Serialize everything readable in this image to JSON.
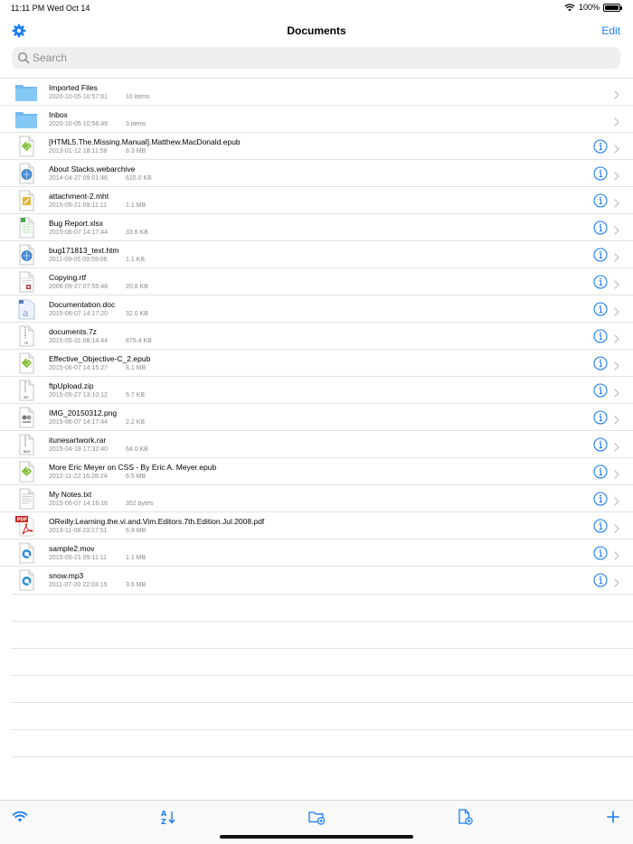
{
  "status_bar": {
    "time": "11:11 PM",
    "date": "Wed Oct 14",
    "battery": "100%"
  },
  "nav": {
    "title": "Documents",
    "edit_label": "Edit"
  },
  "search": {
    "placeholder": "Search"
  },
  "colors": {
    "accent": "#1a7cf3",
    "folder": "#7cc4f2"
  },
  "files": [
    {
      "name": "Imported Files",
      "date": "2020-10-05 10:57:01",
      "size": "10 items",
      "icon": "folder-icon",
      "info": false
    },
    {
      "name": "Inbox",
      "date": "2020-10-05 10:56:49",
      "size": "3 items",
      "icon": "folder-icon",
      "info": false
    },
    {
      "name": "[HTML5.The.Missing.Manual].Matthew.MacDonald.epub",
      "date": "2013-01-12 18:11:58",
      "size": "8.3 MB",
      "icon": "epub-icon",
      "info": true
    },
    {
      "name": "About Stacks.webarchive",
      "date": "2014-04-27 09:01:46",
      "size": "615.0 KB",
      "icon": "webarchive-icon",
      "info": true
    },
    {
      "name": "attachment-2.mht",
      "date": "2015-05-21 09:11:11",
      "size": "1.1 MB",
      "icon": "mht-icon",
      "info": true
    },
    {
      "name": "Bug Report.xlsx",
      "date": "2015-06-07 14:17:44",
      "size": "33.6 KB",
      "icon": "xlsx-icon",
      "info": true
    },
    {
      "name": "bug171813_text.htm",
      "date": "2011-09-05 09:59:06",
      "size": "1.1 KB",
      "icon": "htm-icon",
      "info": true
    },
    {
      "name": "Copying.rtf",
      "date": "2006-09-27 07:55:48",
      "size": "20.8 KB",
      "icon": "rtf-icon",
      "info": true
    },
    {
      "name": "Documentation.doc",
      "date": "2015-06-07 14:17:20",
      "size": "32.0 KB",
      "icon": "doc-icon",
      "info": true
    },
    {
      "name": "documents.7z",
      "date": "2015-05-31 08:14:44",
      "size": "875.4 KB",
      "icon": "archive-7z-icon",
      "info": true
    },
    {
      "name": "Effective_Objective-C_2.epub",
      "date": "2015-06-07 14:15:27",
      "size": "8.1 MB",
      "icon": "epub-icon",
      "info": true
    },
    {
      "name": "ftpUpload.zip",
      "date": "2015-05-27 13:10:12",
      "size": "5.7 KB",
      "icon": "zip-icon",
      "info": true
    },
    {
      "name": "IMG_20150312.png",
      "date": "2015-06-07 14:17:44",
      "size": "2.2 KB",
      "icon": "image-icon",
      "info": true
    },
    {
      "name": "itunesartwork.rar",
      "date": "2015-04-18 17:32:40",
      "size": "64.0 KB",
      "icon": "rar-icon",
      "info": true
    },
    {
      "name": "More Eric Meyer on CSS - By Eric A. Meyer.epub",
      "date": "2012-11-22 16:28:24",
      "size": "6.5 MB",
      "icon": "epub-icon",
      "info": true
    },
    {
      "name": "My Notes.txt",
      "date": "2015-06-07 14:16:16",
      "size": "352 bytes",
      "icon": "txt-icon",
      "info": true
    },
    {
      "name": "OReilly.Learning.the.vi.and.Vim.Editors.7th.Edition.Jul.2008.pdf",
      "date": "2013-11-08 23:17:51",
      "size": "6.9 MB",
      "icon": "pdf-icon",
      "info": true
    },
    {
      "name": "sample2.mov",
      "date": "2015-05-21 09:11:11",
      "size": "1.1 MB",
      "icon": "quicktime-icon",
      "info": true
    },
    {
      "name": "snow.mp3",
      "date": "2011-07-20 22:03:15",
      "size": "3.6 MB",
      "icon": "quicktime-icon",
      "info": true
    }
  ],
  "toolbar": [
    "wifi-icon",
    "sort-az-icon",
    "new-folder-icon",
    "new-file-icon",
    "plus-icon"
  ]
}
